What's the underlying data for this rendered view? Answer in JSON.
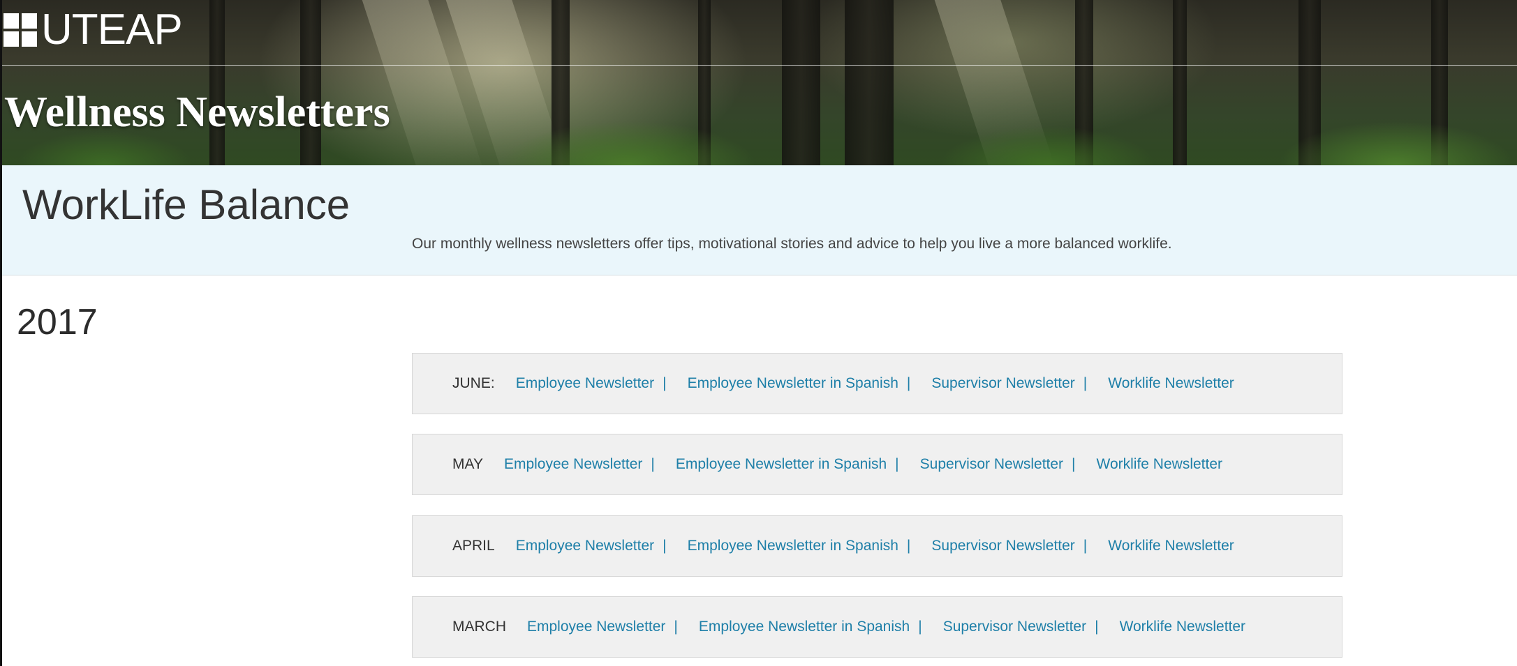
{
  "brand": {
    "logo_text": "UTEAP"
  },
  "banner": {
    "title": "Wellness Newsletters"
  },
  "intro": {
    "title": "WorkLife Balance",
    "description": "Our monthly wellness newsletters offer tips, motivational stories and advice to help you live a more balanced worklife."
  },
  "year": "2017",
  "separator": "|",
  "months": [
    {
      "label": "JUNE:",
      "links": [
        "Employee Newsletter",
        "Employee Newsletter in Spanish",
        "Supervisor Newsletter",
        "Worklife Newsletter"
      ]
    },
    {
      "label": "MAY",
      "links": [
        "Employee Newsletter",
        "Employee Newsletter in Spanish",
        "Supervisor Newsletter",
        "Worklife Newsletter"
      ]
    },
    {
      "label": "APRIL",
      "links": [
        "Employee Newsletter",
        "Employee Newsletter in Spanish",
        "Supervisor Newsletter",
        "Worklife Newsletter"
      ]
    },
    {
      "label": "MARCH",
      "links": [
        "Employee Newsletter",
        "Employee Newsletter in Spanish",
        "Supervisor Newsletter",
        "Worklife Newsletter"
      ]
    }
  ],
  "colors": {
    "link": "#1e7fa8",
    "intro_bg": "#eaf6fb",
    "row_bg": "#f0f0f0"
  }
}
